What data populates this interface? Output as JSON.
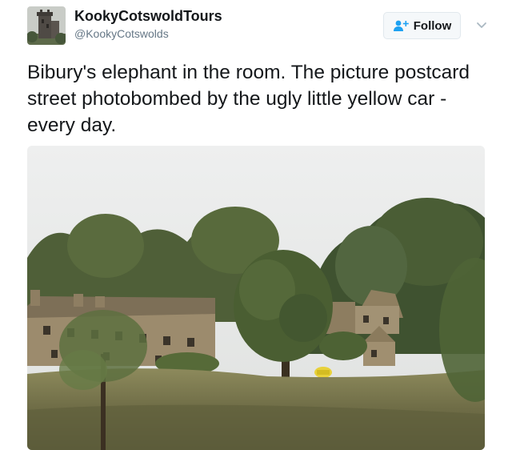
{
  "user": {
    "name": "KookyCotswoldTours",
    "handle": "@KookyCotswolds"
  },
  "follow": {
    "label": "Follow",
    "icon": "add-user-icon"
  },
  "menu": {
    "icon": "chevron-down-icon"
  },
  "tweet": {
    "text": "Bibury's elephant in the room. The picture postcard street photobombed by the ugly little yellow car - every day."
  },
  "colors": {
    "text": "#14171a",
    "secondary": "#657786",
    "accent": "#1da1f2",
    "button_bg": "#f5f8fa",
    "button_border": "#e1e8ed"
  }
}
